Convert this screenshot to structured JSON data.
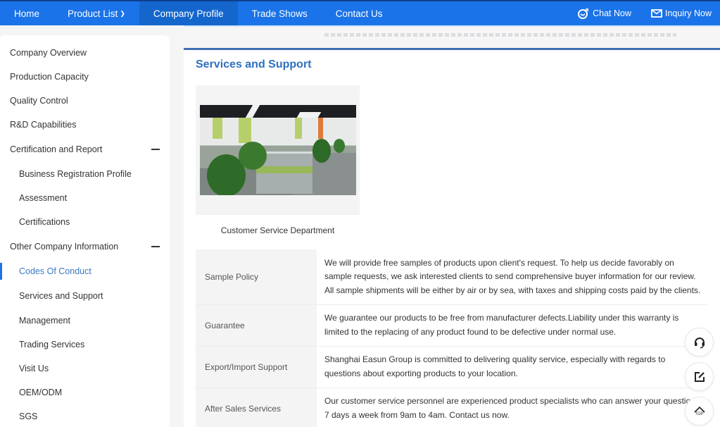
{
  "topnav": {
    "items": [
      {
        "label": "Home"
      },
      {
        "label": "Product List",
        "has_dropdown": true
      },
      {
        "label": "Company Profile",
        "active": true
      },
      {
        "label": "Trade Shows"
      },
      {
        "label": "Contact Us"
      }
    ],
    "chat_label": "Chat Now",
    "inquiry_label": "Inquiry Now",
    "brand_color": "#1a73e8"
  },
  "sidebar": {
    "items": [
      {
        "label": "Company Overview",
        "level": 1
      },
      {
        "label": "Production Capacity",
        "level": 1
      },
      {
        "label": "Quality Control",
        "level": 1
      },
      {
        "label": "R&D Capabilities",
        "level": 1
      },
      {
        "label": "Certification and Report",
        "level": 1,
        "expanded": true
      },
      {
        "label": "Business Registration Profile",
        "level": 2
      },
      {
        "label": "Assessment",
        "level": 2
      },
      {
        "label": "Certifications",
        "level": 2
      },
      {
        "label": "Other Company Information",
        "level": 1,
        "expanded": true
      },
      {
        "label": "Codes Of Conduct",
        "level": 2,
        "active": true
      },
      {
        "label": "Services and Support",
        "level": 2
      },
      {
        "label": "Management",
        "level": 2
      },
      {
        "label": "Trading Services",
        "level": 2
      },
      {
        "label": "Visit Us",
        "level": 2
      },
      {
        "label": "OEM/ODM",
        "level": 2
      },
      {
        "label": "SGS",
        "level": 2
      }
    ]
  },
  "main": {
    "section_title": "Services and Support",
    "photo": {
      "alt": "office-photo",
      "caption": "Customer Service Department"
    },
    "table": [
      {
        "label": "Sample Policy",
        "value": "We will provide free samples of products upon client's request. To help us decide favorably on sample requests, we ask interested clients to send comprehensive buyer information for our review. All sample shipments will be either by air or by sea, with taxes and shipping costs paid by the clients."
      },
      {
        "label": "Guarantee",
        "value": "We guarantee our products to be free from manufacturer defects.Liability under this warranty is limited to the replacing of any product found to be defective under normal use."
      },
      {
        "label": "Export/Import Support",
        "value": "Shanghai Easun Group is committed to delivering quality service, especially with regards to questions about exporting products to your location."
      },
      {
        "label": "After Sales Services",
        "value": "Our customer service personnel are experienced product specialists who can answer your questions 7 days a week from 9am to 4am. Contact us now."
      }
    ]
  },
  "floating": {
    "top_label": "TOP"
  }
}
